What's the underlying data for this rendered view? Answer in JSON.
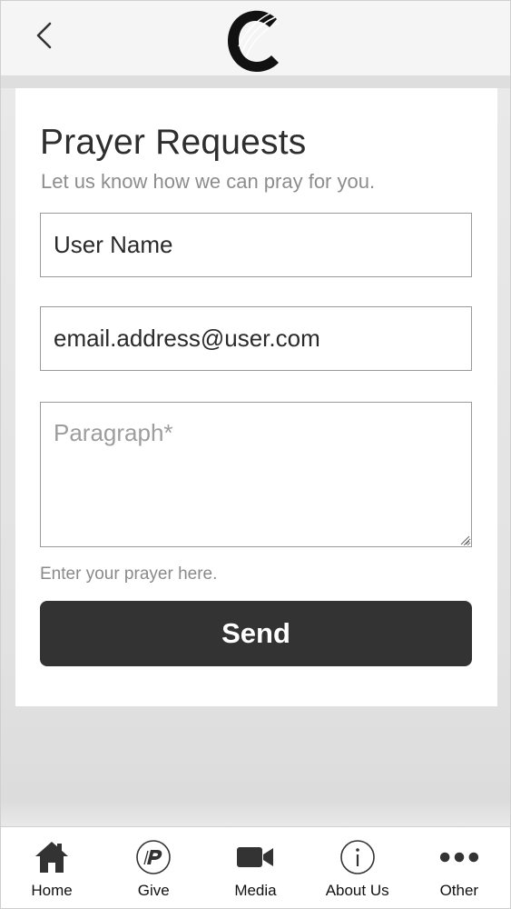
{
  "header": {
    "back_icon": "chevron-left-icon",
    "logo_icon": "church-c-logo"
  },
  "form": {
    "title": "Prayer Requests",
    "subtitle": "Let us know how we can pray for you.",
    "name_value": "User Name",
    "email_value": "email.address@user.com",
    "paragraph_placeholder": "Paragraph*",
    "hint": "Enter your prayer here.",
    "send_label": "Send"
  },
  "tabbar": {
    "items": [
      {
        "label": "Home",
        "icon": "home-icon"
      },
      {
        "label": "Give",
        "icon": "give-p-icon"
      },
      {
        "label": "Media",
        "icon": "video-camera-icon"
      },
      {
        "label": "About Us",
        "icon": "info-icon"
      },
      {
        "label": "Other",
        "icon": "more-dots-icon"
      }
    ]
  },
  "colors": {
    "button_bg": "#333333",
    "text_primary": "#2e2e2e",
    "text_secondary": "#8d8d8d"
  }
}
